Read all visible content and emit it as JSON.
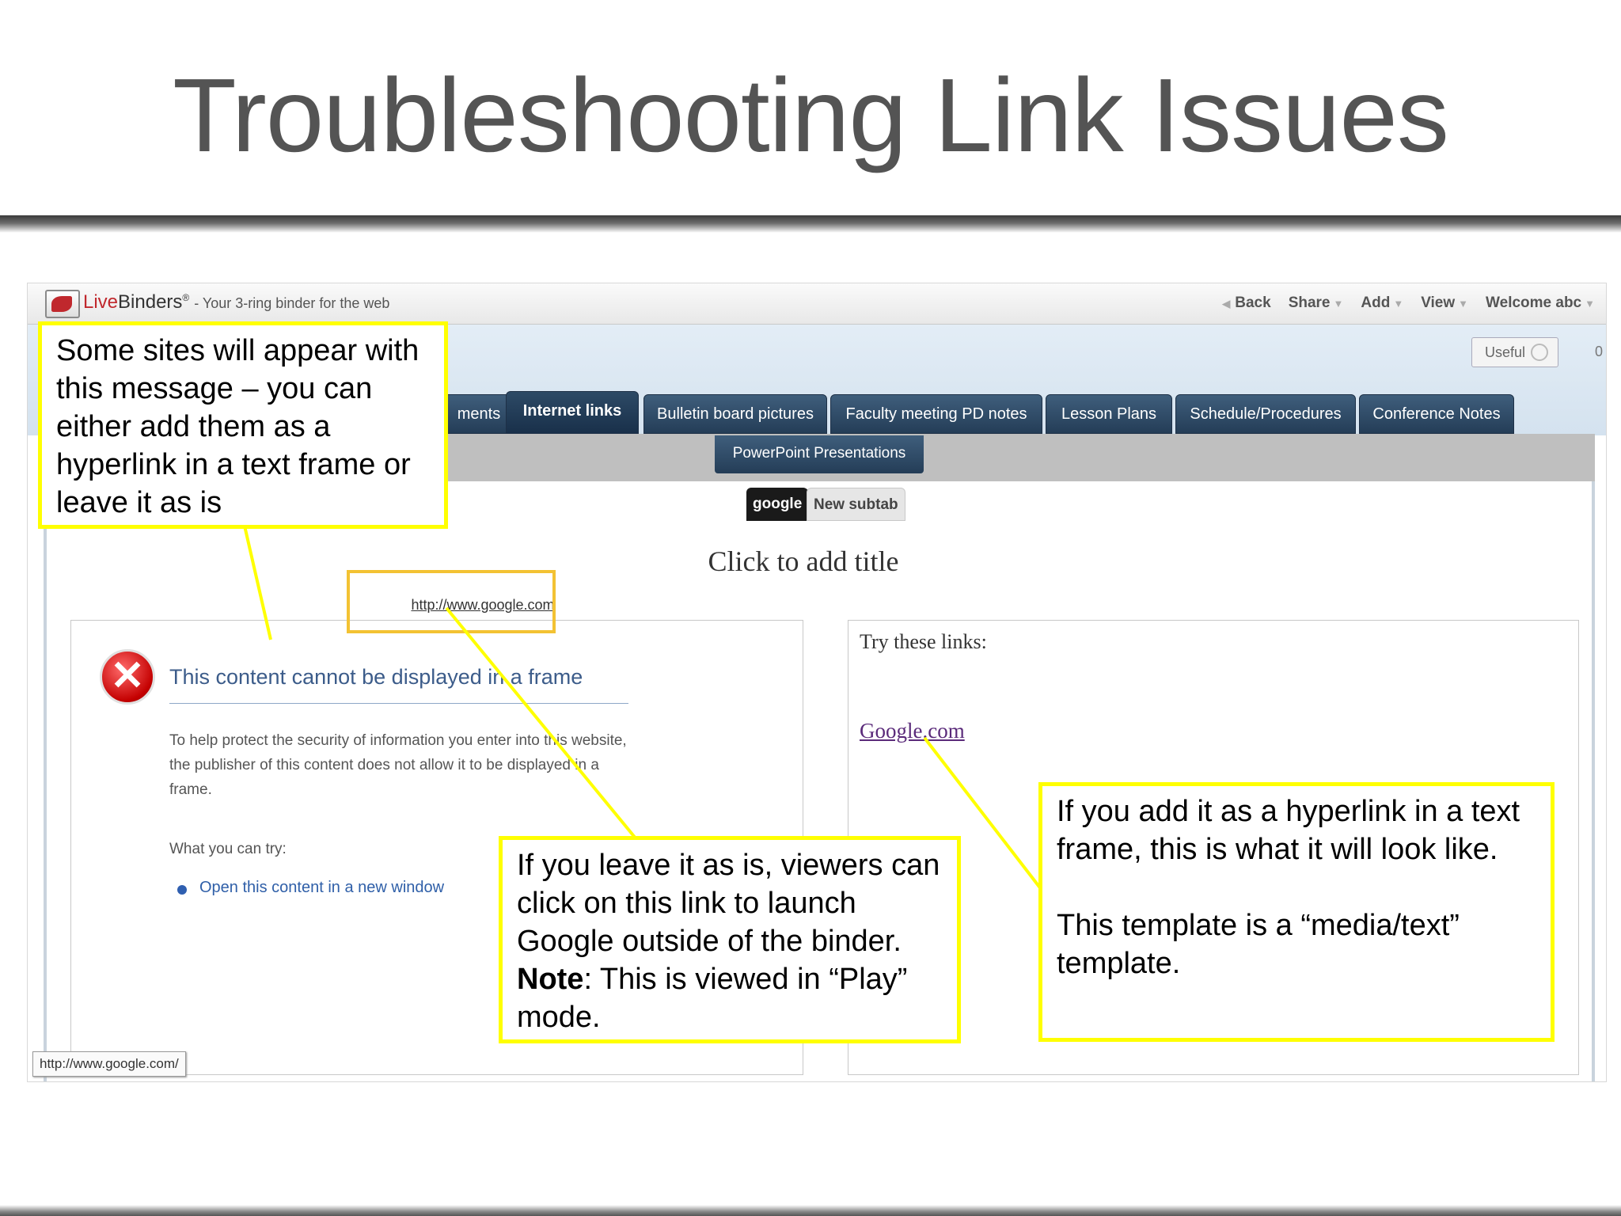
{
  "slide": {
    "title": "Troubleshooting Link Issues"
  },
  "browser": {
    "brand_live": "Live",
    "brand_binders": "Binders",
    "brand_tm": "®",
    "tagline": "- Your 3-ring binder for the web",
    "nav": [
      "Back",
      "Share",
      "Add",
      "View",
      "Welcome abc"
    ],
    "useful_label": "Useful",
    "useful_count": "0",
    "tabs": [
      "ments",
      "Internet links",
      "Bulletin board pictures",
      "Faculty meeting PD notes",
      "Lesson Plans",
      "Schedule/Procedures",
      "Conference Notes"
    ],
    "active_tab": "Internet links",
    "subtab": "PowerPoint Presentations",
    "pills": [
      "google",
      "New subtab"
    ],
    "page_title": "Click to add title",
    "link_url": "http://www.google.com",
    "status_url": "http://www.google.com/"
  },
  "error_frame": {
    "heading": "This content cannot be displayed in a frame",
    "body": "To help protect the security of information you enter into this website, the publisher of this content does not allow it to be displayed in a frame.",
    "try_label": "What you can try:",
    "open_link": "Open this content in a new window"
  },
  "text_frame": {
    "heading": "Try these links:",
    "link": "Google.com"
  },
  "callouts": {
    "top_left": "Some sites will appear with this message – you can either add them as a hyperlink in a text frame or leave it as is",
    "bottom_middle_1": "If you leave it as is, viewers can click on this link to launch Google outside of the binder. ",
    "bottom_middle_note": "Note",
    "bottom_middle_2": ": This is viewed in “Play” mode.",
    "right_1": "If you add it as a hyperlink in a text frame, this is what it will look like.",
    "right_2": "This template is a “media/text” template."
  },
  "colors": {
    "callout_border": "#ffff00",
    "tab_bg": "#2d4a66",
    "link_purple": "#5a2a7a",
    "error_red": "#c40000"
  }
}
